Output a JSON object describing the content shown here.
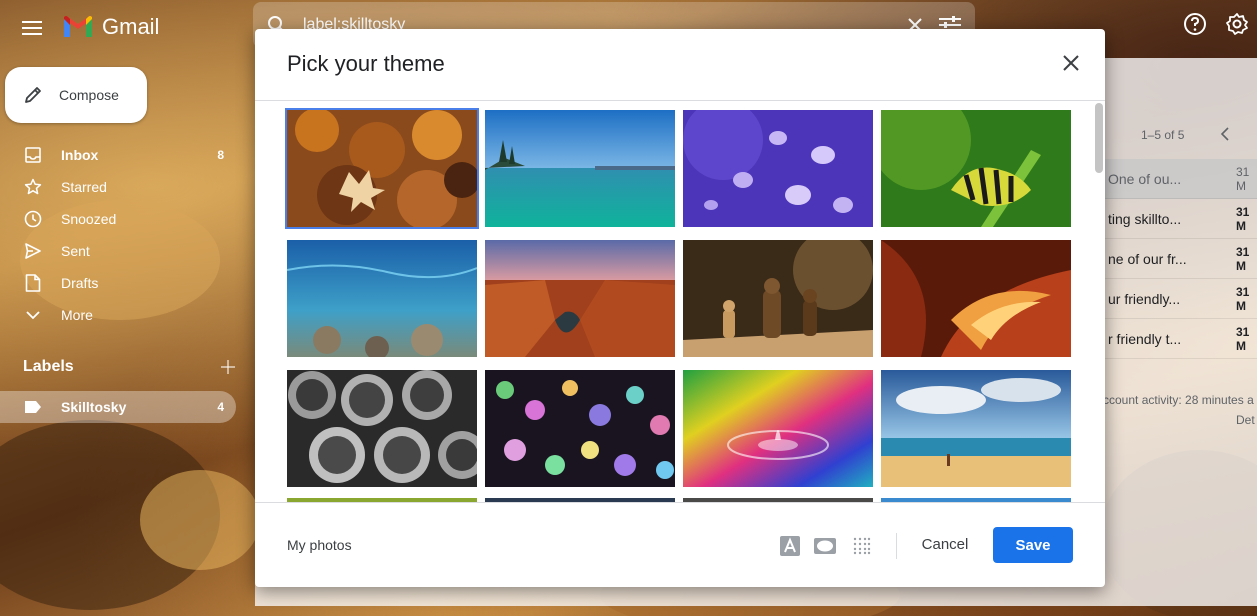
{
  "app": {
    "name": "Gmail"
  },
  "search": {
    "value": "label:skilltosky"
  },
  "sidebar": {
    "compose_label": "Compose",
    "items": [
      {
        "label": "Inbox",
        "count": "8",
        "icon": "inbox-icon",
        "bold": true
      },
      {
        "label": "Starred",
        "count": "",
        "icon": "star-icon"
      },
      {
        "label": "Snoozed",
        "count": "",
        "icon": "clock-icon"
      },
      {
        "label": "Sent",
        "count": "",
        "icon": "send-icon"
      },
      {
        "label": "Drafts",
        "count": "",
        "icon": "draft-icon"
      },
      {
        "label": "More",
        "count": "",
        "icon": "chevron-down-icon"
      }
    ],
    "labels_heading": "Labels",
    "labels": [
      {
        "label": "Skilltosky",
        "count": "4"
      }
    ]
  },
  "mail_list": {
    "paging": "1–5 of 5",
    "rows": [
      {
        "subject": "One of ou...",
        "date": "31 M"
      },
      {
        "subject": "ting skillto...",
        "date": "31 M"
      },
      {
        "subject": "ne of our fr...",
        "date": "31 M"
      },
      {
        "subject": "ur friendly...",
        "date": "31 M"
      },
      {
        "subject": "r friendly t...",
        "date": "31 M"
      }
    ],
    "activity": "ccount activity: 28 minutes a",
    "details": "Det"
  },
  "modal": {
    "title": "Pick your theme",
    "my_photos": "My photos",
    "cancel": "Cancel",
    "save": "Save",
    "themes": [
      {
        "name": "autumn-leaves",
        "selected": true
      },
      {
        "name": "lake"
      },
      {
        "name": "jellyfish"
      },
      {
        "name": "caterpillar"
      },
      {
        "name": "underwater"
      },
      {
        "name": "canyon"
      },
      {
        "name": "chess"
      },
      {
        "name": "antelope-canyon"
      },
      {
        "name": "pipes"
      },
      {
        "name": "bokeh"
      },
      {
        "name": "rainbow-drop"
      },
      {
        "name": "beach"
      }
    ]
  },
  "colors": {
    "accent": "#1a73e8",
    "selection": "#4a7ee8"
  }
}
